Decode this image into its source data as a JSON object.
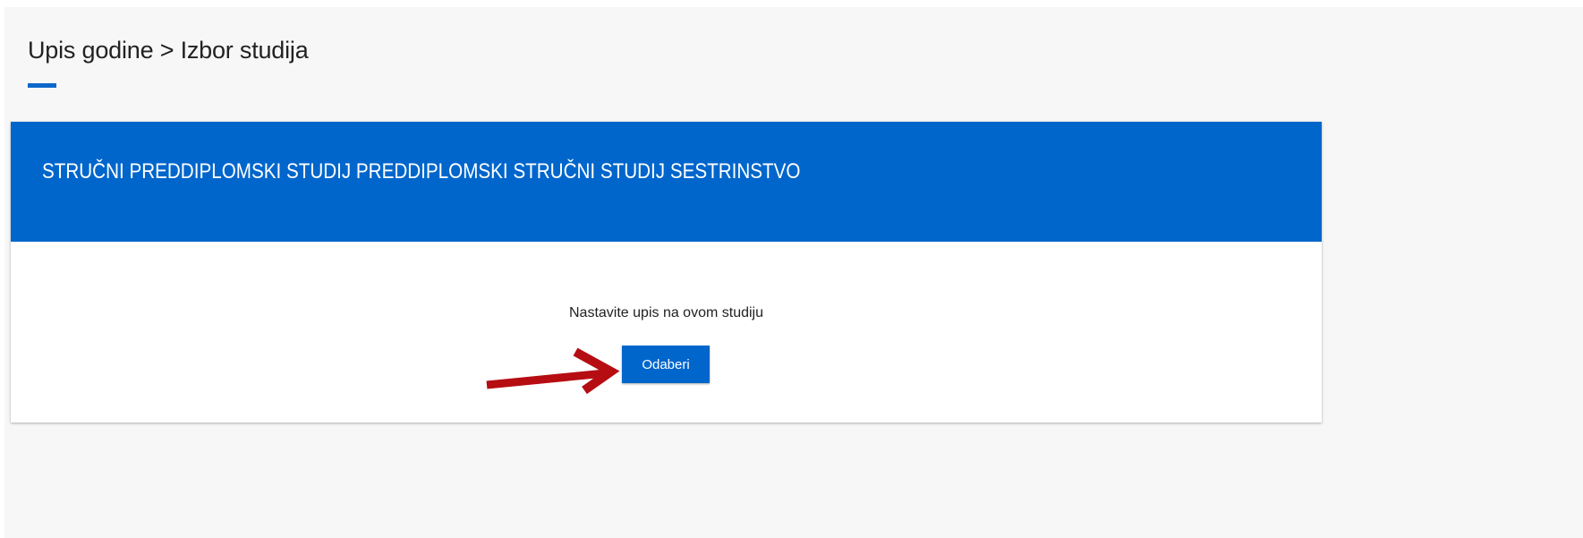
{
  "page": {
    "title": "Upis godine > Izbor studija"
  },
  "study_card": {
    "title": "STRUČNI PREDDIPLOMSKI STUDIJ PREDDIPLOMSKI STRUČNI STUDIJ SESTRINSTVO",
    "continue_text": "Nastavite upis na ovom studiju",
    "select_button_label": "Odaberi"
  },
  "annotation": {
    "icon": "arrow-right-icon",
    "color": "#b50d12"
  },
  "colors": {
    "accent": "#0066cc",
    "background": "#f7f7f7",
    "card": "#ffffff"
  }
}
